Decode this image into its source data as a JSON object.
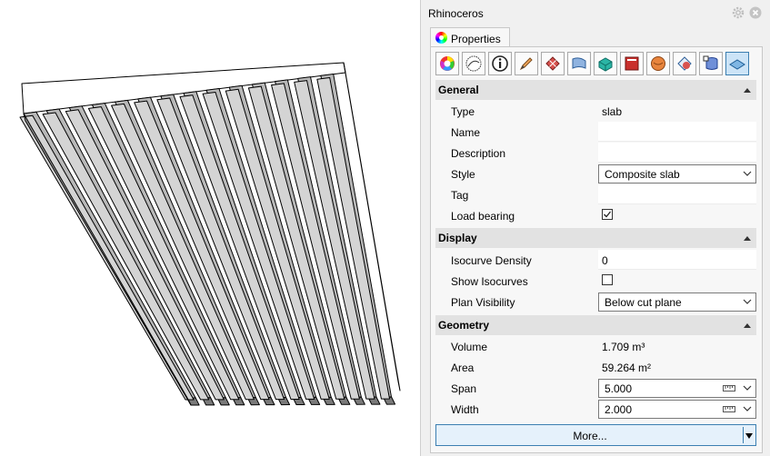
{
  "window": {
    "title": "Rhinoceros"
  },
  "tab": {
    "label": "Properties"
  },
  "toolbar": {
    "icons": [
      "material-color-icon",
      "render-mesh-icon",
      "object-info-icon",
      "pen-icon",
      "texture-mapping-icon",
      "bend-icon",
      "curve-piping-icon",
      "decal-icon",
      "displacement-icon",
      "shadow-icon",
      "layer-database-icon",
      "slab-icon"
    ],
    "active_index": 11
  },
  "sections": {
    "general": {
      "title": "General",
      "rows": {
        "type": {
          "label": "Type",
          "value": "slab"
        },
        "name": {
          "label": "Name",
          "value": ""
        },
        "description": {
          "label": "Description",
          "value": ""
        },
        "style": {
          "label": "Style",
          "value": "Composite slab"
        },
        "tag": {
          "label": "Tag",
          "value": ""
        },
        "load_bearing": {
          "label": "Load bearing",
          "checked": true
        }
      }
    },
    "display": {
      "title": "Display",
      "rows": {
        "isocurve_density": {
          "label": "Isocurve Density",
          "value": "0"
        },
        "show_isocurves": {
          "label": "Show Isocurves",
          "checked": false
        },
        "plan_visibility": {
          "label": "Plan Visibility",
          "value": "Below cut plane"
        }
      }
    },
    "geometry": {
      "title": "Geometry",
      "rows": {
        "volume": {
          "label": "Volume",
          "value": "1.709 m³"
        },
        "area": {
          "label": "Area",
          "value": "59.264 m²"
        },
        "span": {
          "label": "Span",
          "value": "5.000"
        },
        "width": {
          "label": "Width",
          "value": "2.000"
        }
      }
    }
  },
  "more_button": {
    "label": "More..."
  },
  "colors": {
    "accent": "#3c7fb1",
    "section_bg": "#e2e2e2",
    "slab_gray": "#bdbdbd"
  }
}
